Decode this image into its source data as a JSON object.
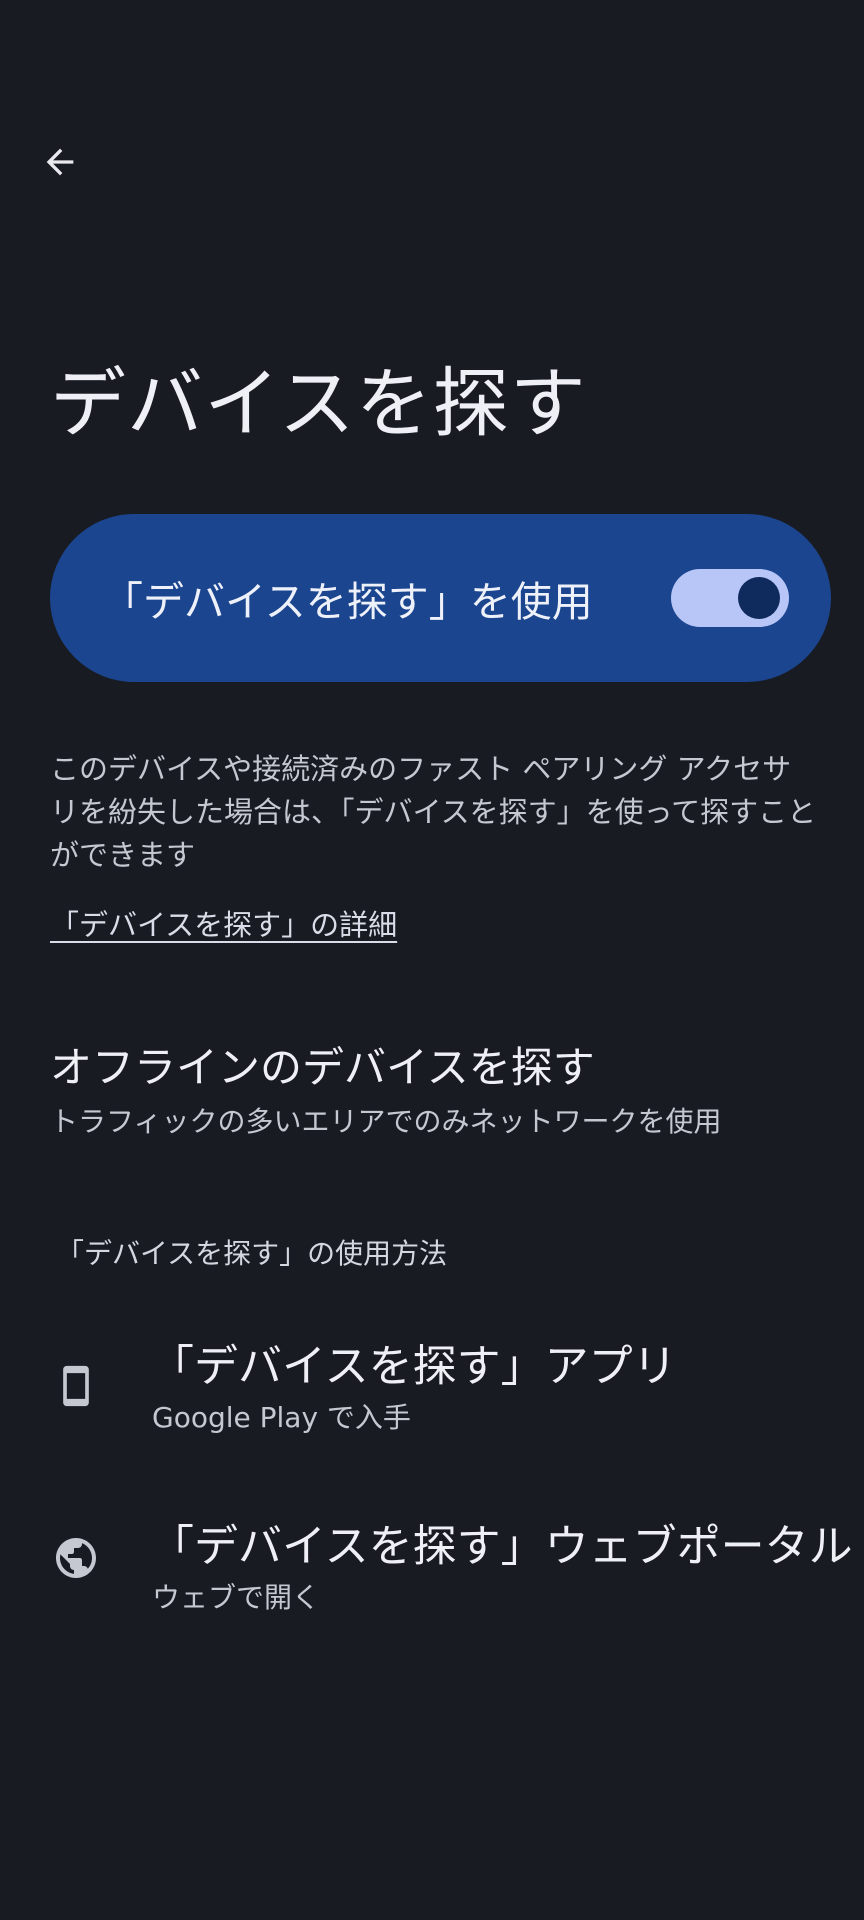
{
  "header": {
    "back_icon": "arrow-back-icon",
    "title": "デバイスを探す"
  },
  "main_toggle": {
    "label": "「デバイスを探す」を使用",
    "enabled": true,
    "colors": {
      "card": "#1b458e",
      "track": "#b7c6f7",
      "thumb": "#0f2a5c"
    }
  },
  "description": "このデバイスや接続済みのファスト ペアリング アクセサリを紛失した場合は、「デバイスを探す」を使って探すことができます",
  "learn_more_link": "「デバイスを探す」の詳細",
  "offline_setting": {
    "title": "オフラインのデバイスを探す",
    "subtitle": "トラフィックの多いエリアでのみネットワークを使用"
  },
  "usage_section": {
    "header": "「デバイスを探す」の使用方法",
    "items": [
      {
        "icon": "phone-icon",
        "title": "「デバイスを探す」アプリ",
        "subtitle": "Google Play で入手"
      },
      {
        "icon": "globe-icon",
        "title": "「デバイスを探す」ウェブポータル",
        "subtitle": "ウェブで開く"
      }
    ]
  }
}
